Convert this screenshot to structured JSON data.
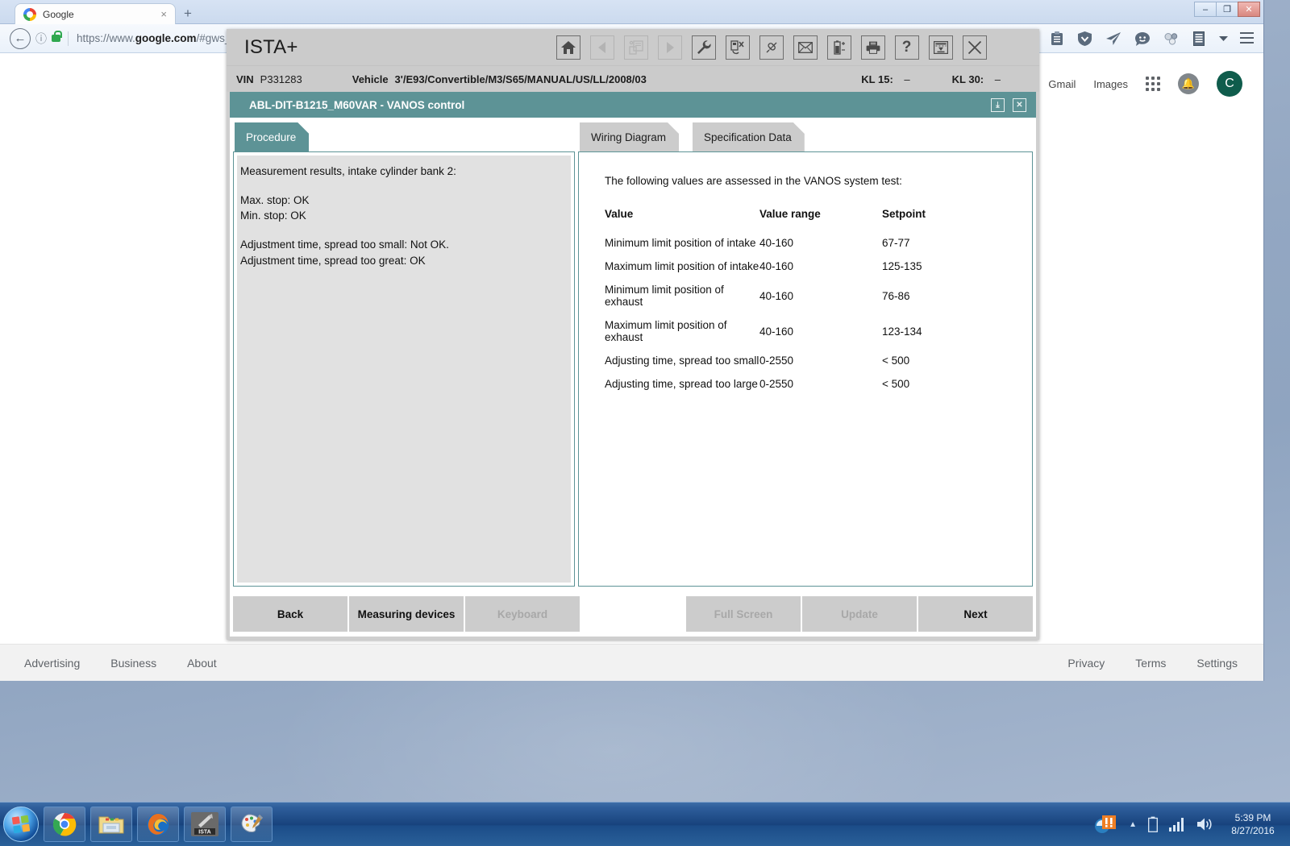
{
  "browser": {
    "tab": {
      "title": "Google",
      "close_label": "×",
      "favicon": "google-favicon"
    },
    "newtab_label": "+",
    "window_controls": {
      "minimize": "–",
      "maximize": "❐",
      "close": "✕"
    },
    "url": {
      "prefix": "https://www.",
      "domain": "google.com",
      "suffix": "/#gws_rd=ss"
    },
    "back_label": "←"
  },
  "google": {
    "links": [
      "Gmail",
      "Images"
    ],
    "avatar_letter": "C",
    "footer_left": [
      "Advertising",
      "Business",
      "About"
    ],
    "footer_right": [
      "Privacy",
      "Terms",
      "Settings"
    ]
  },
  "ista": {
    "logo": "ISTA+",
    "toolbar": [
      {
        "name": "home-icon",
        "enabled": true
      },
      {
        "name": "back-arrow-icon",
        "enabled": false
      },
      {
        "name": "documents-icon",
        "enabled": false
      },
      {
        "name": "forward-arrow-icon",
        "enabled": false
      },
      {
        "name": "wrench-icon",
        "enabled": true
      },
      {
        "name": "vehicle-test-icon",
        "enabled": true
      },
      {
        "name": "connector-icon",
        "enabled": true
      },
      {
        "name": "mail-icon",
        "enabled": true
      },
      {
        "name": "battery-icon",
        "enabled": true
      },
      {
        "name": "printer-icon",
        "enabled": true
      },
      {
        "name": "help-icon",
        "enabled": true
      },
      {
        "name": "minimize-window-icon",
        "enabled": true
      },
      {
        "name": "close-window-icon",
        "enabled": true
      }
    ],
    "vehicle_bar": {
      "vin_label": "VIN",
      "vin_value": "P331283",
      "vehicle_label": "Vehicle",
      "vehicle_value": "3'/E93/Convertible/M3/S65/MANUAL/US/LL/2008/03",
      "kl15_label": "KL 15:",
      "kl15_value": "–",
      "kl30_label": "KL 30:",
      "kl30_value": "–"
    },
    "panel_header": {
      "title": "ABL-DIT-B1215_M60VAR  -  VANOS control",
      "minimize": "⤓",
      "close": "✕"
    },
    "left_tab": {
      "label": "Procedure"
    },
    "right_tabs": [
      {
        "label": "Wiring Diagram",
        "active": false
      },
      {
        "label": "Specification Data",
        "active": false
      }
    ],
    "procedure": {
      "lines": [
        "Measurement results, intake cylinder bank 2:",
        "",
        "Max. stop: OK",
        "Min. stop: OK",
        "",
        "Adjustment time, spread too small: Not OK.",
        "Adjustment time, spread too great: OK"
      ]
    },
    "spec": {
      "intro": "The following values are assessed in the VANOS system test:",
      "headers": [
        "Value",
        "Value range",
        "Setpoint"
      ],
      "rows": [
        [
          "Minimum limit position of intake",
          "40-160",
          "67-77"
        ],
        [
          "Maximum limit position of intake",
          "40-160",
          "125-135"
        ],
        [
          "Minimum limit position of exhaust",
          "40-160",
          "76-86"
        ],
        [
          "Maximum limit position of exhaust",
          "40-160",
          "123-134"
        ],
        [
          "Adjusting time, spread too small",
          "0-2550",
          "< 500"
        ],
        [
          "Adjusting time, spread too large",
          "0-2550",
          "< 500"
        ]
      ]
    },
    "buttons": [
      {
        "label": "Back",
        "enabled": true
      },
      {
        "label": "Measuring devices",
        "enabled": true
      },
      {
        "label": "Keyboard",
        "enabled": false
      },
      {
        "label": "Full Screen",
        "enabled": false
      },
      {
        "label": "Update",
        "enabled": false
      },
      {
        "label": "Next",
        "enabled": true
      }
    ]
  },
  "taskbar": {
    "items": [
      {
        "name": "taskbar-chrome",
        "label": "Google Chrome"
      },
      {
        "name": "taskbar-explorer",
        "label": "Windows Explorer"
      },
      {
        "name": "taskbar-firefox",
        "label": "Mozilla Firefox"
      },
      {
        "name": "taskbar-ista",
        "label": "ISTA"
      },
      {
        "name": "taskbar-paint",
        "label": "Paint"
      }
    ],
    "time": "5:39 PM",
    "date": "8/27/2016"
  },
  "colors": {
    "teal": "#5d9396",
    "gray_panel": "#cbcbcb",
    "tab_inactive": "#cccccc",
    "left_content_bg": "#e1e1e1"
  }
}
